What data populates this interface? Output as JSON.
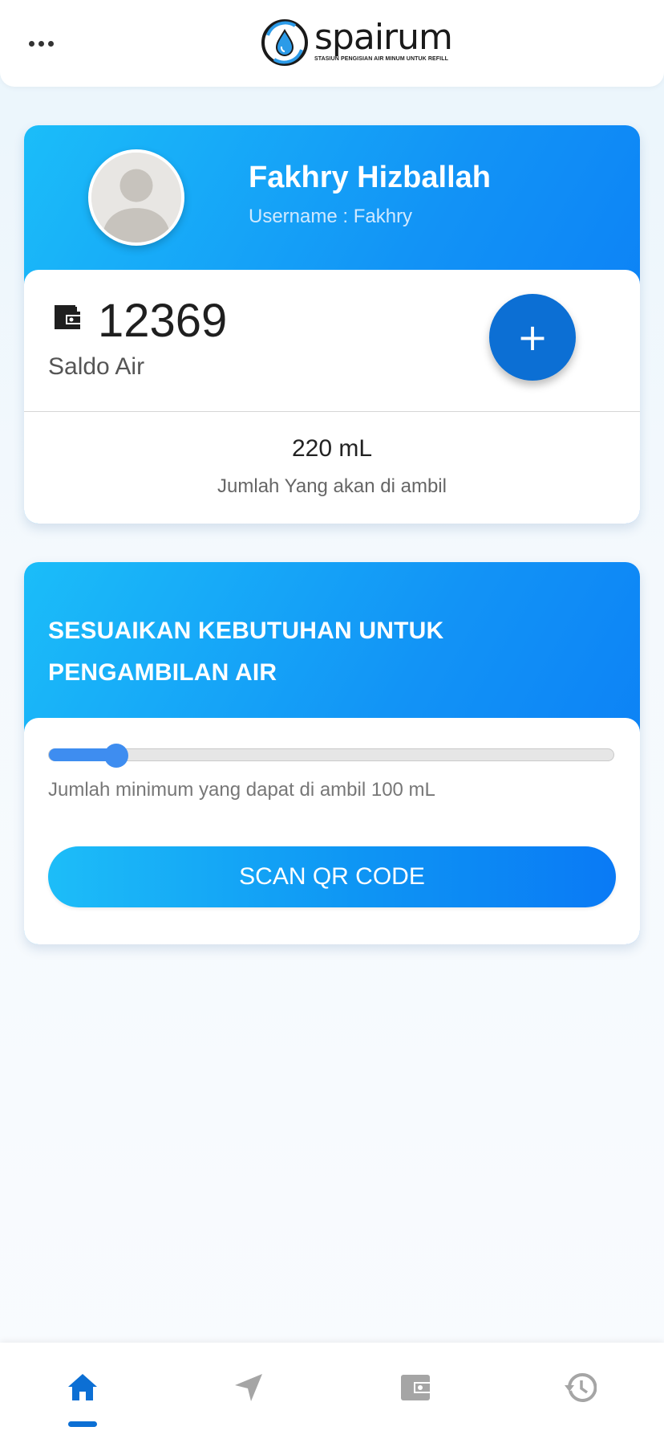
{
  "header": {
    "brand_name": "spairum",
    "brand_tagline": "STASIUN PENGISIAN AIR MINUM UNTUK REFILL",
    "menu_icon": "more-horizontal-icon"
  },
  "profile": {
    "name": "Fakhry Hizballah",
    "username_label": "Username : Fakhry",
    "avatar_icon": "default-avatar-icon"
  },
  "balance": {
    "value": "12369",
    "label": "Saldo Air",
    "icon": "wallet-icon",
    "add_label": "+"
  },
  "withdraw": {
    "amount": "220 mL",
    "label": "Jumlah Yang akan di ambil"
  },
  "adjust": {
    "title": "SESUAIKAN KEBUTUHAN UNTUK PENGAMBILAN AIR",
    "slider_value_fraction": 0.12,
    "helper_text": "Jumlah minimum yang dapat di ambil 100 mL",
    "scan_button_label": "SCAN QR CODE"
  },
  "bottom_nav": {
    "items": [
      {
        "name": "home",
        "icon": "home-icon",
        "active": true
      },
      {
        "name": "navigation",
        "icon": "navigation-arrow-icon",
        "active": false
      },
      {
        "name": "wallet",
        "icon": "wallet-icon",
        "active": false
      },
      {
        "name": "history",
        "icon": "history-icon",
        "active": false
      }
    ]
  },
  "colors": {
    "primary": "#0c6fd4",
    "gradient_start": "#1bbdf9",
    "gradient_end": "#0a7bf5",
    "inactive_icon": "#a5a5a5"
  }
}
